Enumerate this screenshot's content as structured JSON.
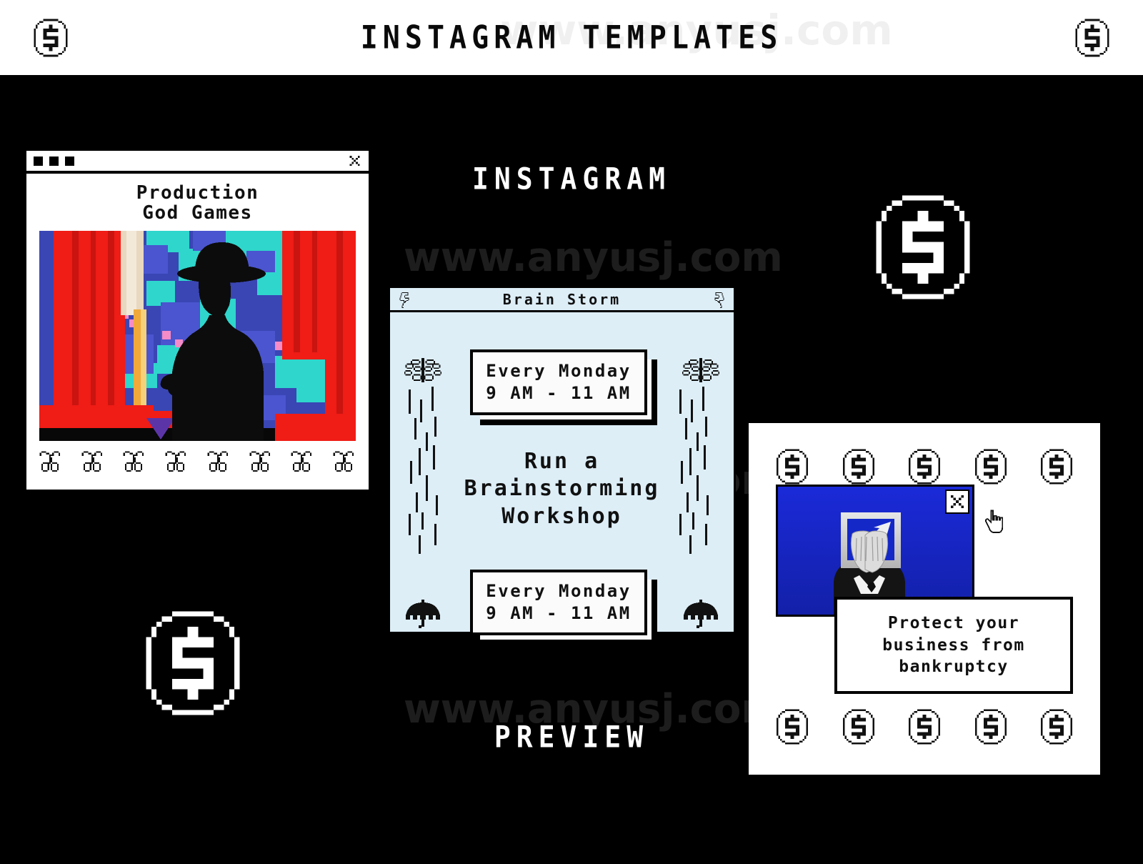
{
  "header": {
    "title": "INSTAGRAM TEMPLATES",
    "coin_icon_left": "dollar-coin-icon",
    "coin_icon_right": "dollar-coin-icon"
  },
  "watermarks": {
    "text": "www.anyusj.com",
    "occurrences": 4
  },
  "center_labels": {
    "top": "INSTAGRAM",
    "bottom": "PREVIEW"
  },
  "cards": {
    "production": {
      "window_title_dots": 3,
      "close_icon": "close-x-icon",
      "heading_line1": "Production",
      "heading_line2": "God Games",
      "photo_alt": "silhouette of person in hat before pixelated red and blue window",
      "cherry_icon": "cherry-icon",
      "cherry_count": 8,
      "colors": {
        "photo_red": "#f01c16",
        "photo_blue": "#3a46b4",
        "photo_cyan": "#2fd6cc",
        "photo_cream": "#e8d8bf"
      }
    },
    "brainstorm": {
      "title": "Brain Storm",
      "bolt_icon": "lightning-bolt-icon",
      "brain_icon": "brain-icon",
      "umbrella_icon": "umbrella-icon",
      "box_top": {
        "line1": "Every Monday",
        "line2": "9 AM - 11 AM"
      },
      "center": {
        "line1": "Run a",
        "line2": "Brainstorming",
        "line3": "Workshop"
      },
      "box_bottom": {
        "line1": "Every Monday",
        "line2": "9 AM - 11 AM"
      },
      "colors": {
        "background": "#ddeef7",
        "border": "#000000"
      }
    },
    "bankruptcy": {
      "coin_icon": "dollar-coin-icon",
      "coin_row_top_count": 5,
      "coin_row_bottom_count": 5,
      "close_icon": "close-x-icon",
      "cursor_icon": "hand-pointer-cursor-icon",
      "photo_alt": "person in suit covering face with hands on blue background",
      "message": {
        "line1": "Protect your",
        "line2": "business from",
        "line3": "bankruptcy"
      },
      "colors": {
        "photo_blue": "#1b28cf",
        "card_background": "#ffffff"
      }
    }
  },
  "decor": {
    "big_coin_icon": "dollar-coin-icon",
    "big_coin_count": 2
  },
  "colors": {
    "page_background": "#000000",
    "header_background": "#ffffff",
    "accent_text": "#ffffff"
  }
}
